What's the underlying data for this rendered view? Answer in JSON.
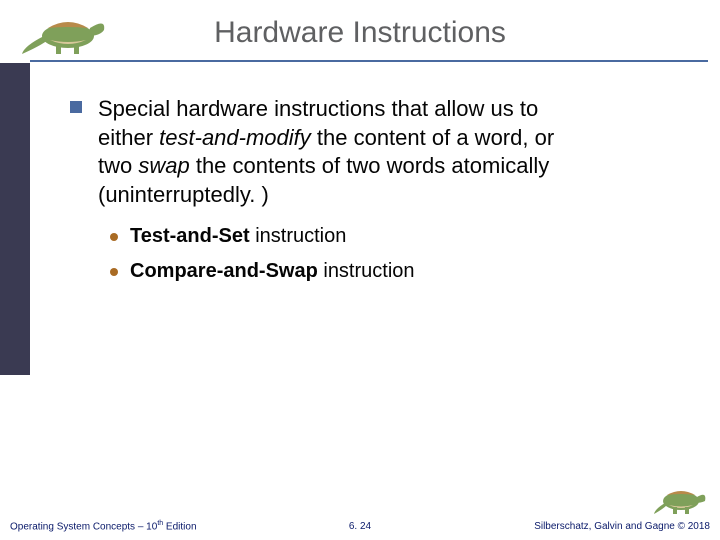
{
  "header": {
    "title": "Hardware Instructions",
    "dino_top_name": "dinosaur-figure"
  },
  "content": {
    "bullet_pre": "Special hardware instructions that allow us to either ",
    "bullet_ital1": "test-and-modify",
    "bullet_mid1": " the content of a word, or two ",
    "bullet_ital2": "swap",
    "bullet_post": " the contents of two words atomically (uninterruptedly. )",
    "sub": [
      {
        "bold": "Test-and-Set",
        "rest": " instruction"
      },
      {
        "bold": "Compare-and-Swap",
        "rest": " instruction"
      }
    ]
  },
  "footer": {
    "left_pre": "Operating System Concepts – 10",
    "left_sup": "th",
    "left_post": " Edition",
    "center": "6. 24",
    "right": "Silberschatz, Galvin and Gagne © 2018",
    "dino_bottom_name": "dinosaur-figure-small"
  }
}
